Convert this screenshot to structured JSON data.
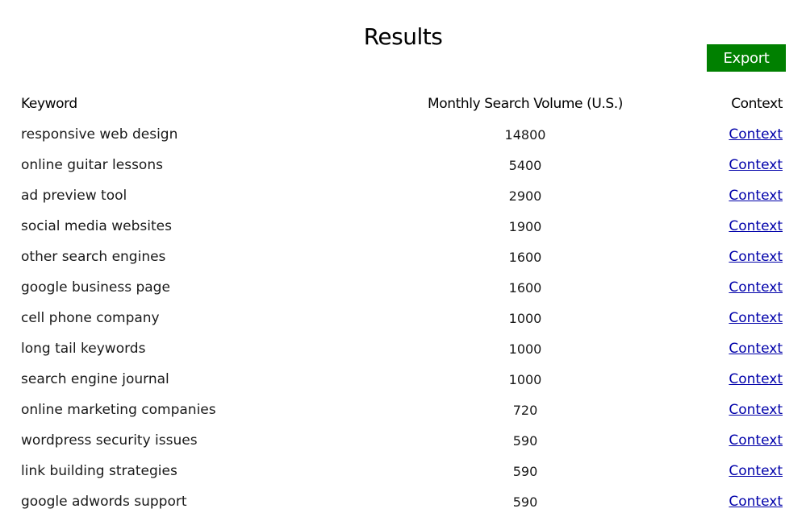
{
  "page": {
    "title": "Results",
    "export_label": "Export",
    "accent_color": "#008000"
  },
  "table": {
    "headers": {
      "keyword": "Keyword",
      "volume": "Monthly Search Volume (U.S.)",
      "context": "Context"
    },
    "rows": [
      {
        "keyword": "responsive web design",
        "volume": "14800",
        "context": "Context"
      },
      {
        "keyword": "online guitar lessons",
        "volume": "5400",
        "context": "Context"
      },
      {
        "keyword": "ad preview tool",
        "volume": "2900",
        "context": "Context"
      },
      {
        "keyword": "social media websites",
        "volume": "1900",
        "context": "Context"
      },
      {
        "keyword": "other search engines",
        "volume": "1600",
        "context": "Context"
      },
      {
        "keyword": "google business page",
        "volume": "1600",
        "context": "Context"
      },
      {
        "keyword": "cell phone company",
        "volume": "1000",
        "context": "Context"
      },
      {
        "keyword": "long tail keywords",
        "volume": "1000",
        "context": "Context"
      },
      {
        "keyword": "search engine journal",
        "volume": "1000",
        "context": "Context"
      },
      {
        "keyword": "online marketing companies",
        "volume": "720",
        "context": "Context"
      },
      {
        "keyword": "wordpress security issues",
        "volume": "590",
        "context": "Context"
      },
      {
        "keyword": "link building strategies",
        "volume": "590",
        "context": "Context"
      },
      {
        "keyword": "google adwords support",
        "volume": "590",
        "context": "Context"
      }
    ]
  }
}
